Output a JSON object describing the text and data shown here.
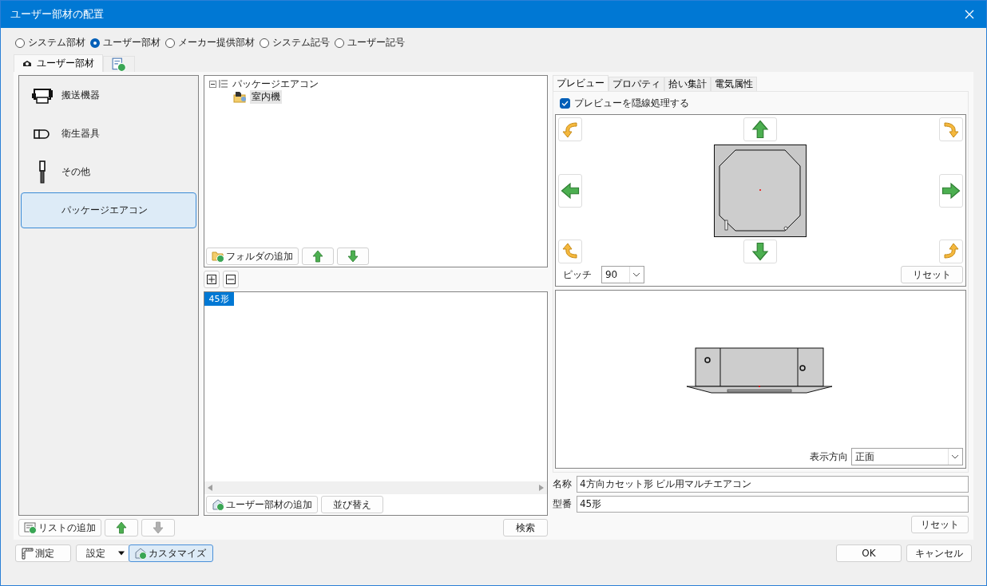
{
  "window": {
    "title": "ユーザー部材の配置"
  },
  "source_options": [
    {
      "label": "システム部材",
      "selected": false
    },
    {
      "label": "ユーザー部材",
      "selected": true
    },
    {
      "label": "メーカー提供部材",
      "selected": false
    },
    {
      "label": "システム記号",
      "selected": false
    },
    {
      "label": "ユーザー記号",
      "selected": false
    }
  ],
  "tabs": [
    {
      "kind": "text",
      "label": "ユーザー部材",
      "selected": true
    },
    {
      "kind": "add",
      "selected": false
    }
  ],
  "categories": [
    {
      "kind": "conveyor",
      "label": "搬送機器",
      "selected": false
    },
    {
      "kind": "sanitary",
      "label": "衛生器具",
      "selected": false
    },
    {
      "kind": "other",
      "label": "その他",
      "selected": false
    },
    {
      "kind": "none",
      "label": "パッケージエアコン",
      "selected": true
    }
  ],
  "category_add": "リストの追加",
  "category_move": [
    {
      "disabled": false
    },
    {
      "disabled": true
    }
  ],
  "tree": [
    {
      "label": "パッケージエアコン",
      "expanded": true,
      "selected": false,
      "children": [
        {
          "label": "室内機",
          "selected": true
        }
      ]
    }
  ],
  "folder_add": "フォルダの追加",
  "parts": [
    {
      "label": "45形",
      "selected": true
    }
  ],
  "parts_buttons": [
    "ユーザー部材の追加",
    "並び替え"
  ],
  "search_button": "検索",
  "preview_tabs": [
    {
      "label": "プレビュー",
      "selected": true
    },
    {
      "label": "プロパティ",
      "selected": false
    },
    {
      "label": "拾い集計",
      "selected": false
    },
    {
      "label": "電気属性",
      "selected": false
    }
  ],
  "hidden_line": {
    "label": "プレビューを隠線処理する",
    "checked": true
  },
  "pitch": {
    "label": "ピッチ",
    "value": "90"
  },
  "pitch_reset": "リセット",
  "view_direction": {
    "label": "表示方向",
    "value": "正面"
  },
  "fields": [
    {
      "label": "名称",
      "value": "4方向カセット形 ビル用マルチエアコン"
    },
    {
      "label": "型番",
      "value": "45形"
    }
  ],
  "field_reset": "リセット",
  "footer_tools": [
    {
      "kind": "measure",
      "label": "測定",
      "active": false
    },
    {
      "kind": "dropdown",
      "label": "設定",
      "active": false
    },
    {
      "kind": "customize",
      "label": "カスタマイズ",
      "active": true
    }
  ],
  "buttons": [
    "OK",
    "キャンセル"
  ]
}
